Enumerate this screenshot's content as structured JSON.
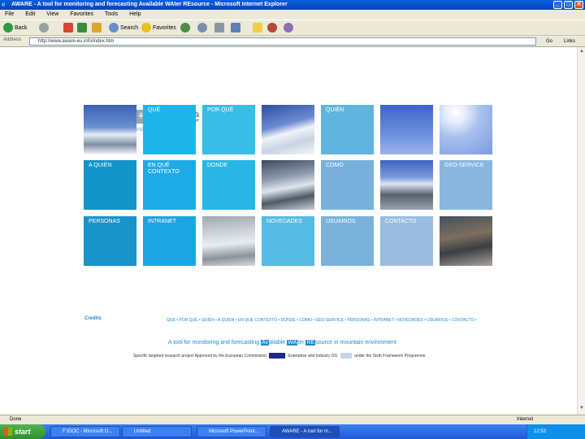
{
  "window": {
    "title": "AWARE - A tool for monitoring and forecasting Available WAter REsource - Microsoft Internet Explorer",
    "controls": [
      "_",
      "□",
      "✕"
    ]
  },
  "menu": [
    "File",
    "Edit",
    "View",
    "Favorites",
    "Tools",
    "Help"
  ],
  "toolbar": {
    "back": "Back",
    "search": "Search",
    "favorites": "Favorites"
  },
  "address": {
    "label": "Address",
    "url": "http://www.aware-eu.info/index.htm",
    "go": "Go",
    "links": "Links"
  },
  "site": {
    "brand": "aware",
    "tagline": "imaging water from snow",
    "logo_icons": [
      "↗",
      "❄",
      "≈",
      "⚘"
    ],
    "tiles": [
      {
        "label": "",
        "kind": "photo-mountain"
      },
      {
        "label": "QUÉ",
        "kind": "text",
        "color": "#1eb4ea"
      },
      {
        "label": "POR QUÉ",
        "kind": "text",
        "color": "#37bde6"
      },
      {
        "label": "",
        "kind": "photo-snow"
      },
      {
        "label": "QUIÉN",
        "kind": "text",
        "color": "#5fb5dd"
      },
      {
        "label": "",
        "kind": "photo-sky"
      },
      {
        "label": "",
        "kind": "photo-sun"
      },
      {
        "label": "A QUIÉN",
        "kind": "text",
        "color": "#1394c9"
      },
      {
        "label": "EN QUÉ\nCONTEXTO",
        "kind": "text",
        "color": "#1eaae6"
      },
      {
        "label": "DONDE",
        "kind": "text",
        "color": "#29b6e6"
      },
      {
        "label": "",
        "kind": "photo-glacier"
      },
      {
        "label": "COMO",
        "kind": "text",
        "color": "#78b0dc"
      },
      {
        "label": "",
        "kind": "photo-peaks"
      },
      {
        "label": "GEO-SERVICE",
        "kind": "text",
        "color": "#88b6df"
      },
      {
        "label": "PERSONAS",
        "kind": "text",
        "color": "#1a93c8"
      },
      {
        "label": "INTRANET",
        "kind": "text",
        "color": "#1ca5e0"
      },
      {
        "label": "",
        "kind": "photo-ice"
      },
      {
        "label": "NOVEDADES",
        "kind": "text",
        "color": "#55bbe2"
      },
      {
        "label": "USUARIOS",
        "kind": "text",
        "color": "#7ab2dc"
      },
      {
        "label": "CONTACTO",
        "kind": "text",
        "color": "#99bce0"
      },
      {
        "label": "",
        "kind": "photo-slope"
      }
    ],
    "credits": "Credits",
    "nav": "QUÉ • POR QUÉ • QUIÉN • A QUIÉN • EN QUÉ CONTEXTO • DONDE • COMO • GEO-SERVICE • PERSONAS • INTRANET • NOVEDADES • USUARIOS • CONTACTO •",
    "desc_prefix": "A tool for monitoring and forecasting",
    "desc_hl1": "Av",
    "desc_mid": "ailable",
    "desc_hl2": "WA",
    "desc_mid2": "ter",
    "desc_hl3": "RE",
    "desc_suffix": "source in mountain environment",
    "fund_text1": "Specific targeted research project Approved by the European Commission",
    "fund_text2": "Enterprise and Industry DG",
    "fund_text3": "under the Sixth Framework Programme"
  },
  "status": {
    "text": "Done",
    "zone": "Internet"
  },
  "taskbar": {
    "start": "start",
    "tasks": [
      "F:\\DOC - Microsoft O...",
      "Untitled",
      "Microsoft PowerPoint...",
      "AWARE - A tool for m..."
    ],
    "clock": "12:53"
  }
}
